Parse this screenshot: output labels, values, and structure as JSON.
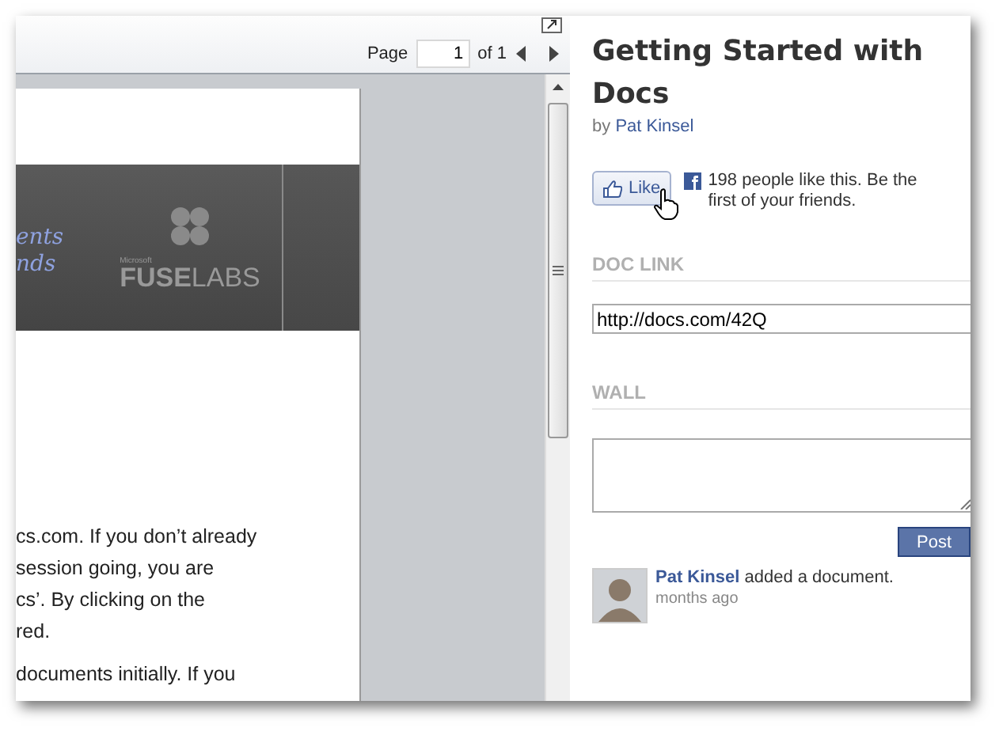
{
  "toolbar": {
    "page_label": "Page",
    "page_value": "1",
    "of_label": "of 1"
  },
  "document": {
    "banner_lines": [
      "ents",
      "nds"
    ],
    "logo_small": "Microsoft",
    "logo_name": "**FUSE**LABS",
    "paragraphs": [
      [
        "cs.com.  If you don’t already",
        "session going, you are",
        "cs’. By clicking on the",
        "red."
      ],
      [
        "documents initially.  If you"
      ]
    ]
  },
  "panel": {
    "title": "Getting Started with Docs",
    "byline_prefix": "by",
    "author": "Pat Kinsel",
    "like_button": "Like",
    "like_text": "198 people like this. Be the first of your friends.",
    "doc_link_heading": "DOC LINK",
    "doc_link_value": "http://docs.com/42Q",
    "wall_heading": "WALL",
    "post_button": "Post",
    "posts": [
      {
        "author": "Pat Kinsel",
        "action": "added a document.",
        "time": "months ago"
      }
    ]
  }
}
